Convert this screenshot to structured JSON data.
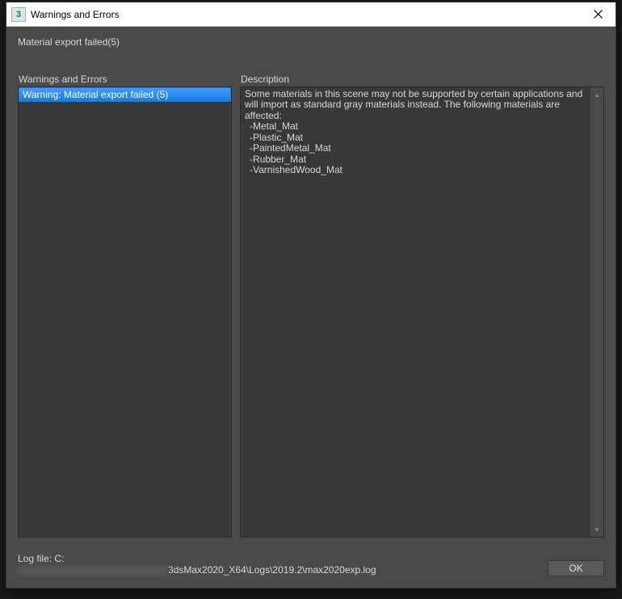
{
  "title_bar": {
    "icon_char": "3",
    "title": "Warnings and Errors"
  },
  "subtitle": "Material export failed(5)",
  "panels": {
    "left_label": "Warnings and Errors",
    "right_label": "Description",
    "list_items": [
      "Warning: Material export failed (5)"
    ],
    "description_intro": "Some materials in this scene may not be supported by certain applications and will import as standard gray materials instead. The following materials are affected:",
    "description_items": [
      "-Metal_Mat",
      "-Plastic_Mat",
      "-PaintedMetal_Mat",
      "-Rubber_Mat",
      "-VarnishedWood_Mat"
    ]
  },
  "footer": {
    "log_label": "Log file: C:",
    "log_path_suffix": "3dsMax2020_X64\\Logs\\2019.2\\max2020exp.log",
    "ok_label": "OK"
  }
}
